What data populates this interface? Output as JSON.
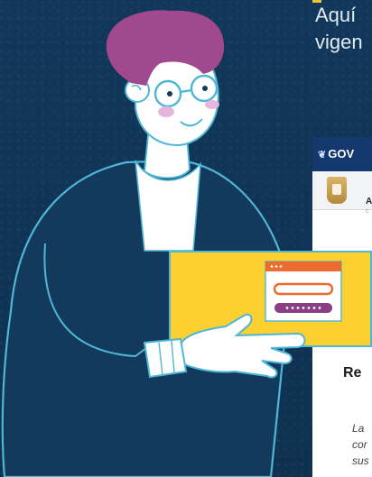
{
  "intro": {
    "heading": "Aquí\nvigen"
  },
  "site": {
    "brand_mark": "❦",
    "brand": "GOV",
    "header_mini_label": "A",
    "header_mini_sub": "C",
    "section_title": "Re",
    "body_text": "La\ncor\nsus"
  },
  "colors": {
    "background": "#103552",
    "card_yellow": "#fcd12f",
    "sweater": "#133a5c",
    "hair": "#a0498f",
    "form_orange": "#ec6c2f",
    "form_purple": "#8a3f85"
  }
}
